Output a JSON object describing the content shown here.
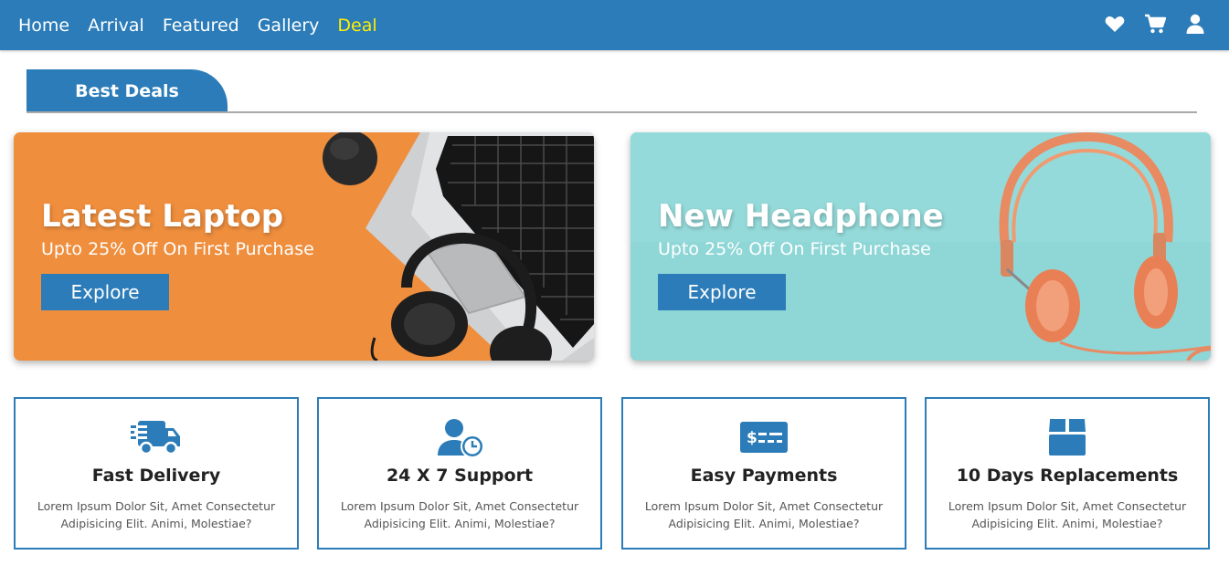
{
  "nav": {
    "links": [
      "Home",
      "Arrival",
      "Featured",
      "Gallery",
      "Deal"
    ],
    "active_link": "Deal",
    "icons": [
      "heart-icon",
      "cart-icon",
      "user-icon"
    ]
  },
  "section": {
    "title": "Best Deals"
  },
  "banners": [
    {
      "title": "Latest Laptop",
      "subtitle": "Upto 25% Off On First Purchase",
      "button": "Explore",
      "bg": "#ef8e3d"
    },
    {
      "title": "New Headphone",
      "subtitle": "Upto 25% Off On First Purchase",
      "button": "Explore",
      "bg": "#8fd6d6"
    }
  ],
  "features": [
    {
      "icon": "delivery-truck-icon",
      "title": "Fast Delivery",
      "desc": "Lorem Ipsum Dolor Sit, Amet Consectetur Adipisicing Elit. Animi, Molestiae?"
    },
    {
      "icon": "user-clock-icon",
      "title": "24 X 7 Support",
      "desc": "Lorem Ipsum Dolor Sit, Amet Consectetur Adipisicing Elit. Animi, Molestiae?"
    },
    {
      "icon": "money-check-icon",
      "title": "Easy Payments",
      "desc": "Lorem Ipsum Dolor Sit, Amet Consectetur Adipisicing Elit. Animi, Molestiae?"
    },
    {
      "icon": "box-icon",
      "title": "10 Days Replacements",
      "desc": "Lorem Ipsum Dolor Sit, Amet Consectetur Adipisicing Elit. Animi, Molestiae?"
    }
  ],
  "colors": {
    "primary": "#2b7cb8",
    "active_nav": "#ffee00",
    "divider": "#a9a9a9"
  }
}
